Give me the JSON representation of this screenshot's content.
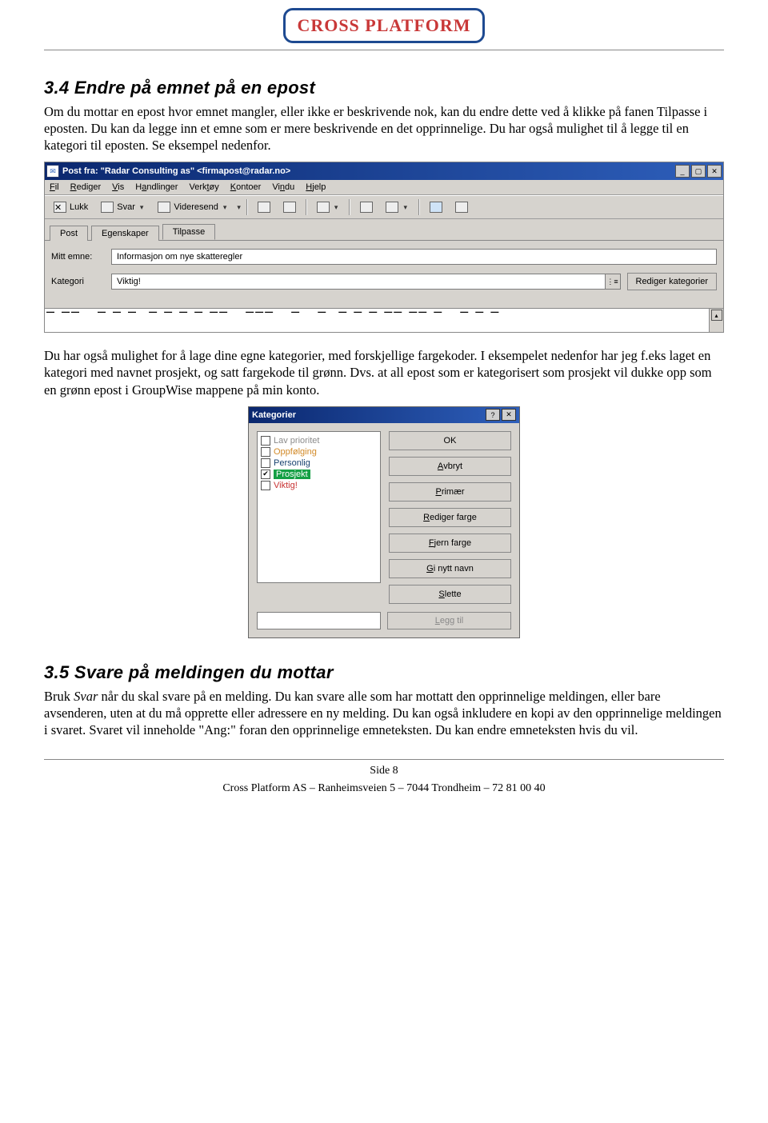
{
  "header": {
    "logo_text": "CROSS PLATFORM"
  },
  "section1": {
    "heading": "3.4 Endre på emnet på en epost",
    "para1": "Om du mottar en epost hvor emnet mangler, eller ikke er beskrivende nok, kan du endre dette ved å klikke på fanen Tilpasse i eposten. Du kan da legge inn et emne som er mere beskrivende en det opprinnelige. Du har også mulighet til å legge til en kategori til eposten. Se eksempel nedenfor."
  },
  "win1": {
    "title": "Post fra: \"Radar Consulting as\" <firmapost@radar.no>",
    "menu": [
      "Fil",
      "Rediger",
      "Vis",
      "Handlinger",
      "Verktøy",
      "Kontoer",
      "Vindu",
      "Hjelp"
    ],
    "toolbar": {
      "lukk": "Lukk",
      "svar": "Svar",
      "videresend": "Videresend"
    },
    "tabs": [
      "Post",
      "Egenskaper",
      "Tilpasse"
    ],
    "label_emne": "Mitt emne:",
    "value_emne": "Informasjon om nye skatteregler",
    "label_kategori": "Kategori",
    "value_kategori": "Viktig!",
    "btn_rediger_kat": "Rediger kategorier"
  },
  "section2": {
    "para": "Du har også mulighet for å lage dine egne kategorier, med forskjellige fargekoder. I eksempelet nedenfor har jeg f.eks laget en kategori med navnet prosjekt, og satt fargekode til grønn. Dvs. at all epost som er kategorisert som prosjekt vil dukke opp som en grønn epost i GroupWise mappene på min konto."
  },
  "dlg2": {
    "title": "Kategorier",
    "items": [
      {
        "label": "Lav prioritet",
        "checked": false,
        "cls": "li-gray"
      },
      {
        "label": "Oppfølging",
        "checked": false,
        "cls": "li-orange"
      },
      {
        "label": "Personlig",
        "checked": false,
        "cls": "li-navy"
      },
      {
        "label": "Prosjekt",
        "checked": true,
        "cls": "li-green"
      },
      {
        "label": "Viktig!",
        "checked": false,
        "cls": "li-red"
      }
    ],
    "btn_ok": "OK",
    "btn_avbryt": "Avbryt",
    "btn_primaer": "Primær",
    "btn_rediger_farge": "Rediger farge",
    "btn_fjern_farge": "Fjern farge",
    "btn_gi_nytt_navn": "Gi nytt navn",
    "btn_slette": "Slette",
    "btn_legg_til": "Legg til"
  },
  "section3": {
    "heading": "3.5 Svare på meldingen du mottar",
    "para_lead": "Bruk ",
    "para_italic": "Svar",
    "para_rest": " når du skal svare på en melding. Du kan svare alle som har mottatt den opprinnelige meldingen, eller bare avsenderen, uten at du må opprette eller adressere en ny melding. Du kan også inkludere en kopi av den opprinnelige meldingen i svaret. Svaret vil inneholde \"Ang:\" foran den opprinnelige emneteksten. Du kan endre emneteksten hvis du vil."
  },
  "footer": {
    "page": "Side 8",
    "line": "Cross Platform AS – Ranheimsveien 5 – 7044 Trondheim – 72 81 00 40"
  }
}
